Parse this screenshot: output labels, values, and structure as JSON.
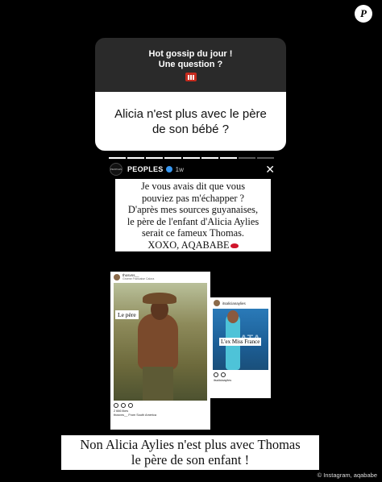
{
  "watermark": {
    "letter": "P"
  },
  "question_card": {
    "header_line1": "Hot gossip du jour !",
    "header_line2": "Une question ?",
    "header_emoji": "hotel-emoji",
    "question": "Alicia n'est plus avec le père de son bébé ?"
  },
  "story": {
    "segments_total": 9,
    "segments_done": 7,
    "avatar_text": "PEOPLES",
    "account": "PEOPLES",
    "age": "1w",
    "close_icon": "close-icon",
    "caption_lines": [
      "Je vous avais dit que vous",
      "pouviez pas m'échapper ?",
      "D'après mes sources guyanaises,",
      "le père de l'enfant d'Alicia Aylies",
      "serait ce fameux Thomas.",
      "XOXO, AQABABE"
    ],
    "caption_emoji": "kiss-mark-emoji"
  },
  "post1": {
    "username": "thosvns__",
    "location": "Groene Francaise Calora",
    "photo_label": "Le père",
    "likes": "2 666 likes",
    "caption": "thosvns__ From South America"
  },
  "post2": {
    "username": "itsalicianaylies",
    "photo_label": "L'ex Miss France",
    "caption": "itsaliciaaylies"
  },
  "banner": {
    "line1": "Non Alicia Aylies n'est plus avec Thomas",
    "line2": "le père de son enfant !"
  },
  "credit": "© Instagram, aqababe",
  "colors": {
    "background": "#000000",
    "card_header": "#2a2a2a",
    "verified": "#3897f0"
  }
}
